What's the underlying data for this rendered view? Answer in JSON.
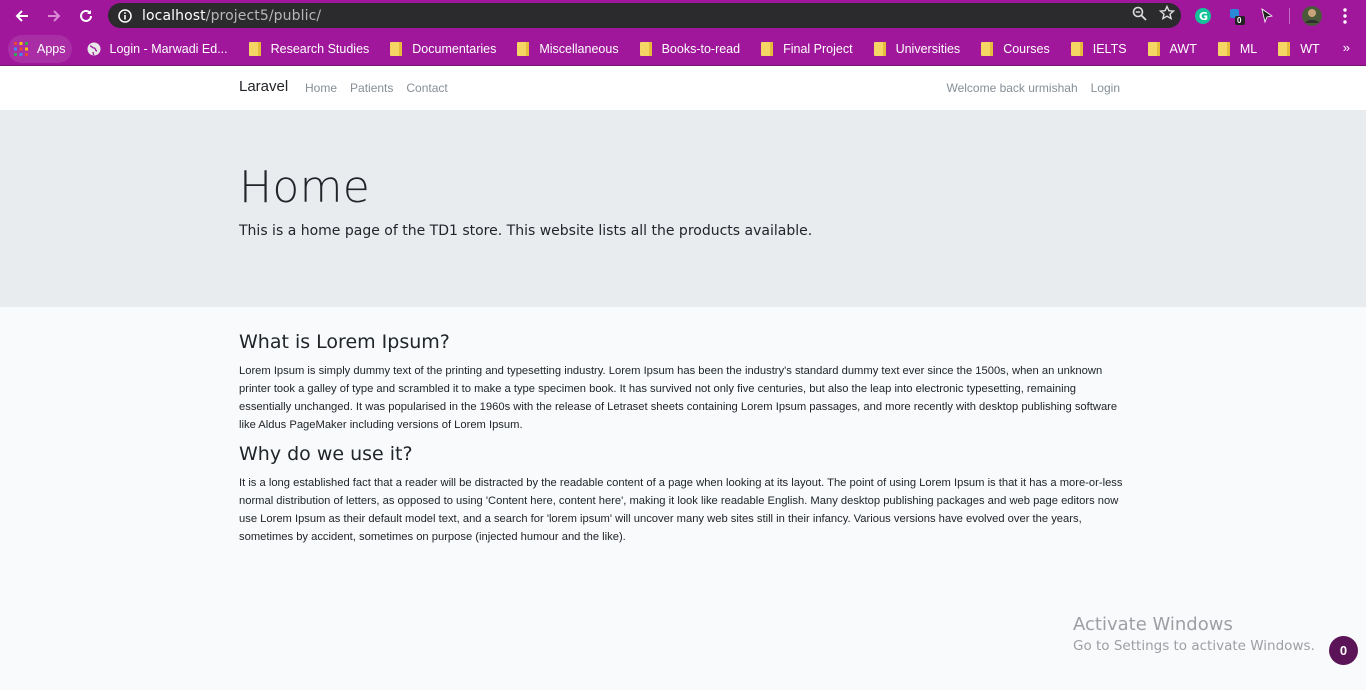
{
  "browser": {
    "url_host": "localhost",
    "url_path": "/project5/public/",
    "extension_badge_count": "0",
    "icons": [
      "back-icon",
      "forward-icon",
      "reload-icon",
      "info-icon",
      "zoom-icon",
      "star-icon",
      "grammarly-icon",
      "extension-icon",
      "cursor-icon",
      "avatar",
      "menu-icon"
    ],
    "accent_color": "#a0179b"
  },
  "bookmarks": {
    "apps_label": "Apps",
    "items": [
      "Login - Marwadi Ed...",
      "Research Studies",
      "Documentaries",
      "Miscellaneous",
      "Books-to-read",
      "Final Project",
      "Universities",
      "Courses",
      "IELTS",
      "AWT",
      "ML",
      "WT"
    ],
    "more_label": "»"
  },
  "navbar": {
    "brand": "Laravel",
    "links": [
      "Home",
      "Patients",
      "Contact"
    ],
    "welcome": "Welcome back urmishah",
    "login": "Login"
  },
  "jumbotron": {
    "title": "Home",
    "subtitle": "This is a home page of the TD1 store. This website lists all the products available."
  },
  "sections": [
    {
      "heading": "What is Lorem Ipsum?",
      "body": "Lorem Ipsum is simply dummy text of the printing and typesetting industry. Lorem Ipsum has been the industry's standard dummy text ever since the 1500s, when an unknown printer took a galley of type and scrambled it to make a type specimen book. It has survived not only five centuries, but also the leap into electronic typesetting, remaining essentially unchanged. It was popularised in the 1960s with the release of Letraset sheets containing Lorem Ipsum passages, and more recently with desktop publishing software like Aldus PageMaker including versions of Lorem Ipsum."
    },
    {
      "heading": "Why do we use it?",
      "body": "It is a long established fact that a reader will be distracted by the readable content of a page when looking at its layout. The point of using Lorem Ipsum is that it has a more-or-less normal distribution of letters, as opposed to using 'Content here, content here', making it look like readable English. Many desktop publishing packages and web page editors now use Lorem Ipsum as their default model text, and a search for 'lorem ipsum' will uncover many web sites still in their infancy. Various versions have evolved over the years, sometimes by accident, sometimes on purpose (injected humour and the like)."
    }
  ],
  "watermark": {
    "line1": "Activate Windows",
    "line2": "Go to Settings to activate Windows."
  },
  "chat_badge": "0"
}
